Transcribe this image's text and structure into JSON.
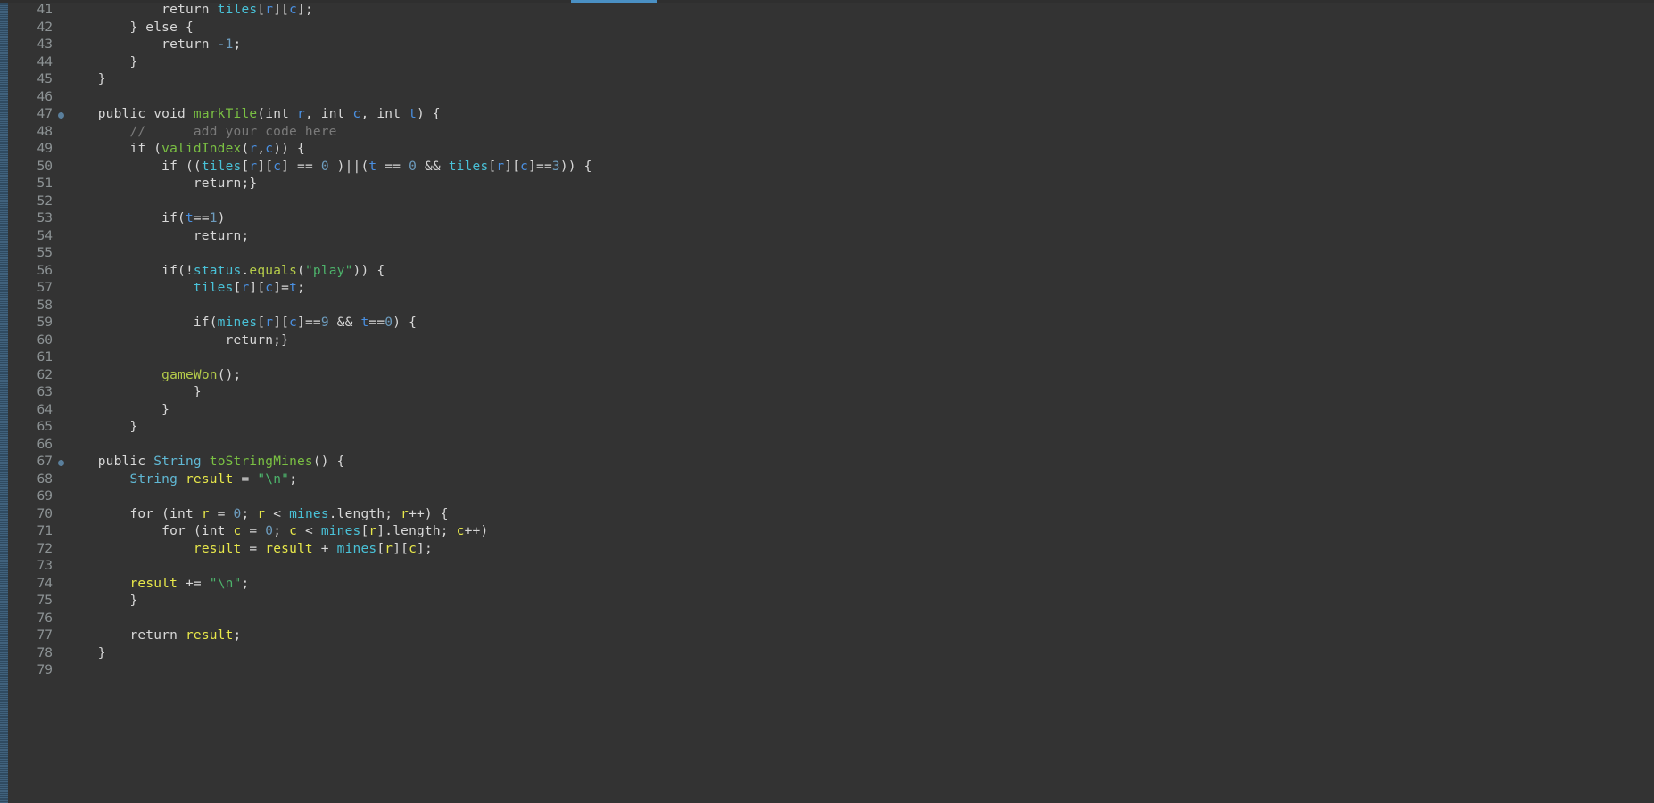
{
  "editor": {
    "theme_background": "#333333",
    "gutter_background": "#333333",
    "marker_bar_color": "#3c5a73",
    "tab_accent_color": "#4a90c4",
    "first_visible_line": 41,
    "last_visible_line": 79,
    "language": "Java"
  },
  "colors": {
    "plain_text": "#d8d8d8",
    "line_number": "#8d9395",
    "type": "#60b8d4",
    "method_declaration": "#7ac043",
    "field": "#49c2d8",
    "parameter": "#4a90e2",
    "local_variable": "#e8e84a",
    "number": "#6d9cbe",
    "string": "#4db36b",
    "comment": "#7a7a7a",
    "method_call": "#b5cc4a"
  },
  "lines": [
    {
      "number": "41",
      "marker": false,
      "tokens": [
        {
          "text": "            return ",
          "cls": "t-plain"
        },
        {
          "text": "tiles",
          "cls": "t-field"
        },
        {
          "text": "[",
          "cls": "t-punct"
        },
        {
          "text": "r",
          "cls": "t-param"
        },
        {
          "text": "][",
          "cls": "t-punct"
        },
        {
          "text": "c",
          "cls": "t-param"
        },
        {
          "text": "];",
          "cls": "t-punct"
        }
      ]
    },
    {
      "number": "42",
      "marker": false,
      "tokens": [
        {
          "text": "        } else {",
          "cls": "t-plain"
        }
      ]
    },
    {
      "number": "43",
      "marker": false,
      "tokens": [
        {
          "text": "            return ",
          "cls": "t-plain"
        },
        {
          "text": "-1",
          "cls": "t-num"
        },
        {
          "text": ";",
          "cls": "t-punct"
        }
      ]
    },
    {
      "number": "44",
      "marker": false,
      "tokens": [
        {
          "text": "        }",
          "cls": "t-plain"
        }
      ]
    },
    {
      "number": "45",
      "marker": false,
      "tokens": [
        {
          "text": "    }",
          "cls": "t-plain"
        }
      ]
    },
    {
      "number": "46",
      "marker": false,
      "tokens": []
    },
    {
      "number": "47",
      "marker": true,
      "tokens": [
        {
          "text": "    public void ",
          "cls": "t-plain"
        },
        {
          "text": "markTile",
          "cls": "t-method"
        },
        {
          "text": "(int ",
          "cls": "t-plain"
        },
        {
          "text": "r",
          "cls": "t-param"
        },
        {
          "text": ", int ",
          "cls": "t-plain"
        },
        {
          "text": "c",
          "cls": "t-param"
        },
        {
          "text": ", int ",
          "cls": "t-plain"
        },
        {
          "text": "t",
          "cls": "t-param"
        },
        {
          "text": ") {",
          "cls": "t-plain"
        }
      ]
    },
    {
      "number": "48",
      "marker": false,
      "tokens": [
        {
          "text": "        //      add your code here",
          "cls": "t-comment"
        }
      ]
    },
    {
      "number": "49",
      "marker": false,
      "tokens": [
        {
          "text": "        if (",
          "cls": "t-plain"
        },
        {
          "text": "validIndex",
          "cls": "t-method"
        },
        {
          "text": "(",
          "cls": "t-punct"
        },
        {
          "text": "r",
          "cls": "t-param"
        },
        {
          "text": ",",
          "cls": "t-punct"
        },
        {
          "text": "c",
          "cls": "t-param"
        },
        {
          "text": ")) {",
          "cls": "t-plain"
        }
      ]
    },
    {
      "number": "50",
      "marker": false,
      "tokens": [
        {
          "text": "            if ((",
          "cls": "t-plain"
        },
        {
          "text": "tiles",
          "cls": "t-field"
        },
        {
          "text": "[",
          "cls": "t-punct"
        },
        {
          "text": "r",
          "cls": "t-param"
        },
        {
          "text": "][",
          "cls": "t-punct"
        },
        {
          "text": "c",
          "cls": "t-param"
        },
        {
          "text": "] == ",
          "cls": "t-plain"
        },
        {
          "text": "0",
          "cls": "t-num"
        },
        {
          "text": " )||(",
          "cls": "t-plain"
        },
        {
          "text": "t",
          "cls": "t-param"
        },
        {
          "text": " == ",
          "cls": "t-plain"
        },
        {
          "text": "0",
          "cls": "t-num"
        },
        {
          "text": " && ",
          "cls": "t-plain"
        },
        {
          "text": "tiles",
          "cls": "t-field"
        },
        {
          "text": "[",
          "cls": "t-punct"
        },
        {
          "text": "r",
          "cls": "t-param"
        },
        {
          "text": "][",
          "cls": "t-punct"
        },
        {
          "text": "c",
          "cls": "t-param"
        },
        {
          "text": "]==",
          "cls": "t-plain"
        },
        {
          "text": "3",
          "cls": "t-num"
        },
        {
          "text": ")) {",
          "cls": "t-plain"
        }
      ]
    },
    {
      "number": "51",
      "marker": false,
      "tokens": [
        {
          "text": "                return;}",
          "cls": "t-plain"
        }
      ]
    },
    {
      "number": "52",
      "marker": false,
      "tokens": []
    },
    {
      "number": "53",
      "marker": false,
      "tokens": [
        {
          "text": "            if(",
          "cls": "t-plain"
        },
        {
          "text": "t",
          "cls": "t-param"
        },
        {
          "text": "==",
          "cls": "t-plain"
        },
        {
          "text": "1",
          "cls": "t-num"
        },
        {
          "text": ")",
          "cls": "t-plain"
        }
      ]
    },
    {
      "number": "54",
      "marker": false,
      "tokens": [
        {
          "text": "                return;",
          "cls": "t-plain"
        }
      ]
    },
    {
      "number": "55",
      "marker": false,
      "tokens": []
    },
    {
      "number": "56",
      "marker": false,
      "tokens": [
        {
          "text": "            if(!",
          "cls": "t-plain"
        },
        {
          "text": "status",
          "cls": "t-field"
        },
        {
          "text": ".",
          "cls": "t-punct"
        },
        {
          "text": "equals",
          "cls": "t-call"
        },
        {
          "text": "(",
          "cls": "t-punct"
        },
        {
          "text": "\"play\"",
          "cls": "t-str"
        },
        {
          "text": ")) {",
          "cls": "t-plain"
        }
      ]
    },
    {
      "number": "57",
      "marker": false,
      "tokens": [
        {
          "text": "                ",
          "cls": "t-plain"
        },
        {
          "text": "tiles",
          "cls": "t-field"
        },
        {
          "text": "[",
          "cls": "t-punct"
        },
        {
          "text": "r",
          "cls": "t-param"
        },
        {
          "text": "][",
          "cls": "t-punct"
        },
        {
          "text": "c",
          "cls": "t-param"
        },
        {
          "text": "]=",
          "cls": "t-plain"
        },
        {
          "text": "t",
          "cls": "t-param"
        },
        {
          "text": ";",
          "cls": "t-punct"
        }
      ]
    },
    {
      "number": "58",
      "marker": false,
      "tokens": []
    },
    {
      "number": "59",
      "marker": false,
      "tokens": [
        {
          "text": "                if(",
          "cls": "t-plain"
        },
        {
          "text": "mines",
          "cls": "t-field"
        },
        {
          "text": "[",
          "cls": "t-punct"
        },
        {
          "text": "r",
          "cls": "t-param"
        },
        {
          "text": "][",
          "cls": "t-punct"
        },
        {
          "text": "c",
          "cls": "t-param"
        },
        {
          "text": "]==",
          "cls": "t-plain"
        },
        {
          "text": "9",
          "cls": "t-num"
        },
        {
          "text": " && ",
          "cls": "t-plain"
        },
        {
          "text": "t",
          "cls": "t-param"
        },
        {
          "text": "==",
          "cls": "t-plain"
        },
        {
          "text": "0",
          "cls": "t-num"
        },
        {
          "text": ") {",
          "cls": "t-plain"
        }
      ]
    },
    {
      "number": "60",
      "marker": false,
      "tokens": [
        {
          "text": "                    return;}",
          "cls": "t-plain"
        }
      ]
    },
    {
      "number": "61",
      "marker": false,
      "tokens": []
    },
    {
      "number": "62",
      "marker": false,
      "tokens": [
        {
          "text": "            ",
          "cls": "t-plain"
        },
        {
          "text": "gameWon",
          "cls": "t-call"
        },
        {
          "text": "();",
          "cls": "t-punct"
        }
      ]
    },
    {
      "number": "63",
      "marker": false,
      "tokens": [
        {
          "text": "                }",
          "cls": "t-plain"
        }
      ]
    },
    {
      "number": "64",
      "marker": false,
      "tokens": [
        {
          "text": "            }",
          "cls": "t-plain"
        }
      ]
    },
    {
      "number": "65",
      "marker": false,
      "tokens": [
        {
          "text": "        }",
          "cls": "t-plain"
        }
      ]
    },
    {
      "number": "66",
      "marker": false,
      "tokens": []
    },
    {
      "number": "67",
      "marker": true,
      "tokens": [
        {
          "text": "    public ",
          "cls": "t-plain"
        },
        {
          "text": "String",
          "cls": "t-type"
        },
        {
          "text": " ",
          "cls": "t-plain"
        },
        {
          "text": "toStringMines",
          "cls": "t-method"
        },
        {
          "text": "() {",
          "cls": "t-plain"
        }
      ]
    },
    {
      "number": "68",
      "marker": false,
      "tokens": [
        {
          "text": "        ",
          "cls": "t-plain"
        },
        {
          "text": "String",
          "cls": "t-type"
        },
        {
          "text": " ",
          "cls": "t-plain"
        },
        {
          "text": "result",
          "cls": "t-local"
        },
        {
          "text": " = ",
          "cls": "t-plain"
        },
        {
          "text": "\"\\n\"",
          "cls": "t-str"
        },
        {
          "text": ";",
          "cls": "t-punct"
        }
      ]
    },
    {
      "number": "69",
      "marker": false,
      "tokens": []
    },
    {
      "number": "70",
      "marker": false,
      "tokens": [
        {
          "text": "        for (int ",
          "cls": "t-plain"
        },
        {
          "text": "r",
          "cls": "t-local"
        },
        {
          "text": " = ",
          "cls": "t-plain"
        },
        {
          "text": "0",
          "cls": "t-num"
        },
        {
          "text": "; ",
          "cls": "t-plain"
        },
        {
          "text": "r",
          "cls": "t-local"
        },
        {
          "text": " < ",
          "cls": "t-plain"
        },
        {
          "text": "mines",
          "cls": "t-field"
        },
        {
          "text": ".length; ",
          "cls": "t-plain"
        },
        {
          "text": "r",
          "cls": "t-local"
        },
        {
          "text": "++) {",
          "cls": "t-plain"
        }
      ]
    },
    {
      "number": "71",
      "marker": false,
      "tokens": [
        {
          "text": "            for (int ",
          "cls": "t-plain"
        },
        {
          "text": "c",
          "cls": "t-local"
        },
        {
          "text": " = ",
          "cls": "t-plain"
        },
        {
          "text": "0",
          "cls": "t-num"
        },
        {
          "text": "; ",
          "cls": "t-plain"
        },
        {
          "text": "c",
          "cls": "t-local"
        },
        {
          "text": " < ",
          "cls": "t-plain"
        },
        {
          "text": "mines",
          "cls": "t-field"
        },
        {
          "text": "[",
          "cls": "t-punct"
        },
        {
          "text": "r",
          "cls": "t-local"
        },
        {
          "text": "].length; ",
          "cls": "t-plain"
        },
        {
          "text": "c",
          "cls": "t-local"
        },
        {
          "text": "++)",
          "cls": "t-plain"
        }
      ]
    },
    {
      "number": "72",
      "marker": false,
      "tokens": [
        {
          "text": "                ",
          "cls": "t-plain"
        },
        {
          "text": "result",
          "cls": "t-local"
        },
        {
          "text": " = ",
          "cls": "t-plain"
        },
        {
          "text": "result",
          "cls": "t-local"
        },
        {
          "text": " + ",
          "cls": "t-plain"
        },
        {
          "text": "mines",
          "cls": "t-field"
        },
        {
          "text": "[",
          "cls": "t-punct"
        },
        {
          "text": "r",
          "cls": "t-local"
        },
        {
          "text": "][",
          "cls": "t-punct"
        },
        {
          "text": "c",
          "cls": "t-local"
        },
        {
          "text": "];",
          "cls": "t-punct"
        }
      ]
    },
    {
      "number": "73",
      "marker": false,
      "tokens": []
    },
    {
      "number": "74",
      "marker": false,
      "tokens": [
        {
          "text": "        ",
          "cls": "t-plain"
        },
        {
          "text": "result",
          "cls": "t-local"
        },
        {
          "text": " += ",
          "cls": "t-plain"
        },
        {
          "text": "\"\\n\"",
          "cls": "t-str"
        },
        {
          "text": ";",
          "cls": "t-punct"
        }
      ]
    },
    {
      "number": "75",
      "marker": false,
      "tokens": [
        {
          "text": "        }",
          "cls": "t-plain"
        }
      ]
    },
    {
      "number": "76",
      "marker": false,
      "tokens": []
    },
    {
      "number": "77",
      "marker": false,
      "tokens": [
        {
          "text": "        return ",
          "cls": "t-plain"
        },
        {
          "text": "result",
          "cls": "t-local"
        },
        {
          "text": ";",
          "cls": "t-punct"
        }
      ]
    },
    {
      "number": "78",
      "marker": false,
      "tokens": [
        {
          "text": "    }",
          "cls": "t-plain"
        }
      ]
    },
    {
      "number": "79",
      "marker": false,
      "tokens": []
    }
  ]
}
